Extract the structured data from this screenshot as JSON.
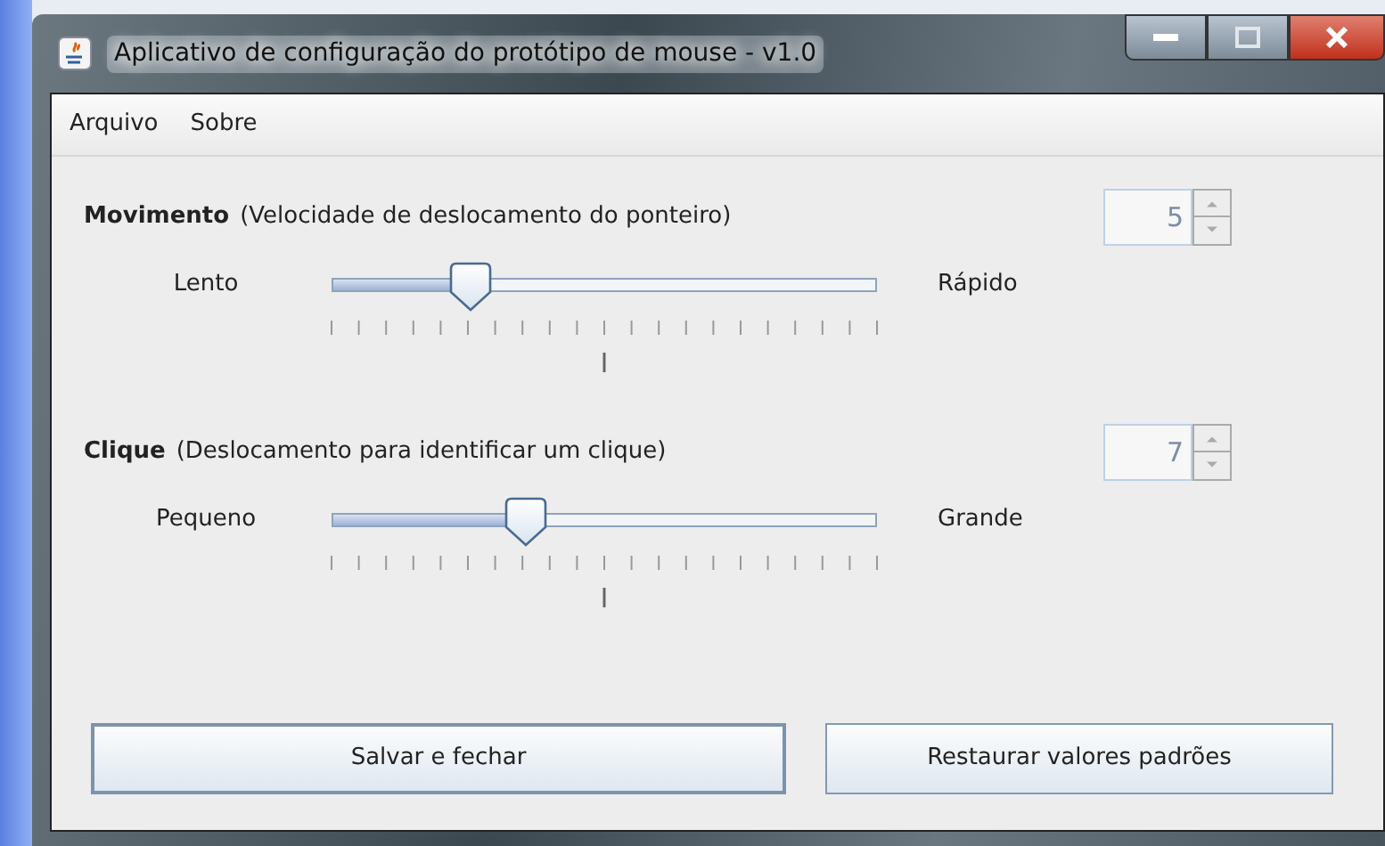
{
  "window": {
    "title": "Aplicativo de configuração do protótipo de mouse - v1.0"
  },
  "menu": [
    "Arquivo",
    "Sobre"
  ],
  "settings": [
    {
      "title": "Movimento",
      "description": "(Velocidade de deslocamento do ponteiro)",
      "min_label": "Lento",
      "max_label": "Rápido",
      "level": 0.25,
      "value": "5",
      "disabled": true
    },
    {
      "title": "Clique",
      "description": "(Deslocamento para identificar um clique)",
      "min_label": "Pequeno",
      "max_label": "Grande",
      "level": 0.35,
      "value": "7",
      "disabled": true
    }
  ],
  "buttons": [
    {
      "label": "Salvar e fechar",
      "focused": true
    },
    {
      "label": "Restaurar valores padrões",
      "focused": false
    }
  ]
}
